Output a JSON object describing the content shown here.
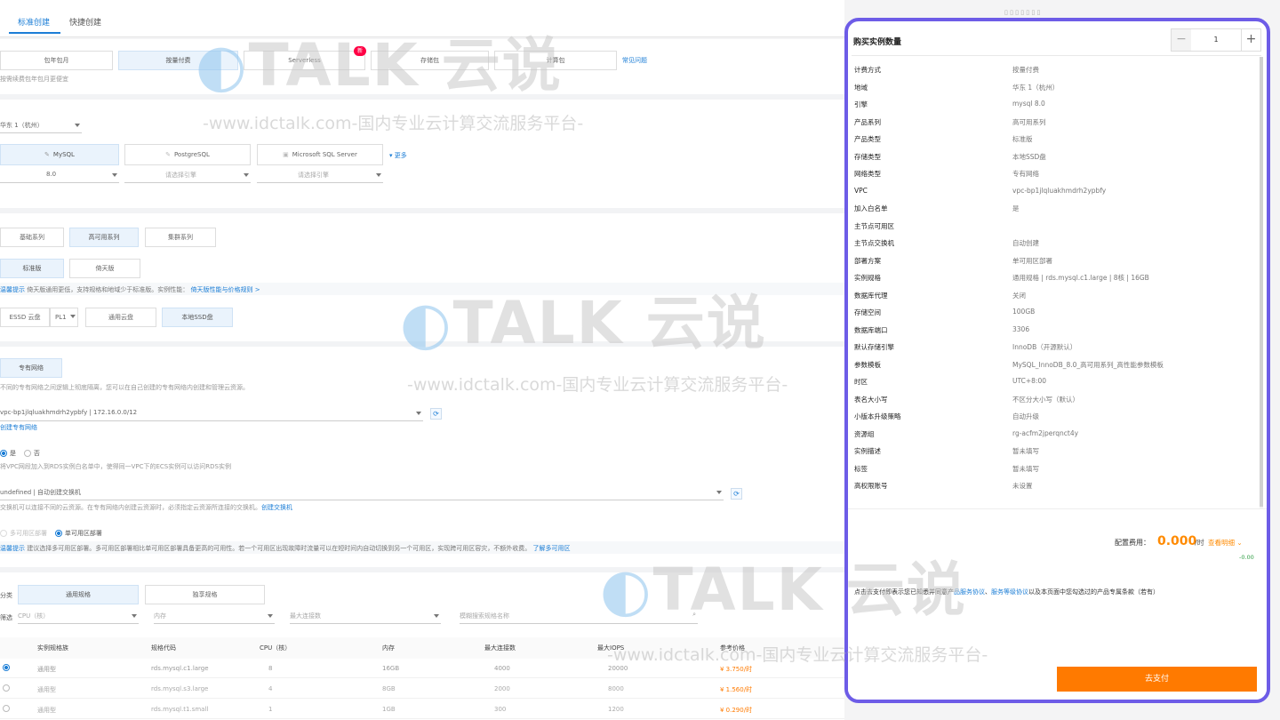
{
  "tabs": [
    {
      "label": "标准创建"
    },
    {
      "label": "快捷创建"
    }
  ],
  "top_right": "▯ ▯ ▯ ▯ ▯ ▯ ▯",
  "billing": {
    "options": [
      "包年包月",
      "按量付费",
      "Serverless",
      "存储包",
      "计算包"
    ],
    "new_badge": "新",
    "note": "按需续费包年包月更便宜",
    "help_link": "常见问题"
  },
  "region": {
    "value": "华东 1（杭州）"
  },
  "engines": [
    {
      "name": "MySQL",
      "version": "8.0"
    },
    {
      "name": "PostgreSQL",
      "version": "请选择引擎"
    },
    {
      "name": "Microsoft SQL Server",
      "version": "请选择引擎"
    }
  ],
  "engines_more": "▾ 更多",
  "series": [
    "基础系列",
    "高可用系列",
    "集群系列"
  ],
  "edition": [
    "标准版",
    "倚天版"
  ],
  "edition_hint": {
    "label": "温馨提示",
    "text": "倚天版通用更低，支持规格和地域少于标准版。实例性能：",
    "link": "倚天版性能与价格规则 >"
  },
  "storage": {
    "type": "ESSD 云盘",
    "level": "PL1",
    "options": [
      "通用云盘",
      "本地SSD盘"
    ]
  },
  "network": {
    "type": "专有网络",
    "desc": "不同的专有网络之间逻辑上彻底隔离，您可以在自己创建的专有网络内创建和管理云资源。",
    "vpc": "vpc-bp1jlqluakhmdrh2ypbfy | 172.16.0.0/12",
    "vpc_link": "创建专有网络"
  },
  "whitelist": {
    "yes": "是",
    "no": "否",
    "note": "将VPC网段加入到RDS实例白名单中，使得同一VPC下的ECS实例可以访问RDS实例"
  },
  "vswitch": {
    "value": "undefined | 自动创建交换机",
    "note": "交换机可以连接不同的云资源。在专有网络内创建云资源时，必须指定云资源所连接的交换机。",
    "link": "创建交换机"
  },
  "deploy": {
    "multi": "多可用区部署",
    "single": "单可用区部署",
    "hint_label": "温馨提示",
    "hint_text": "建议选择多可用区部署。多可用区部署相比单可用区部署具备更高的可用性。若一个可用区出现故障时流量可以在短时间内自动切换到另一个可用区，实现跨可用区容灾，不额外收费。",
    "hint_link": "了解多可用区"
  },
  "spec_type": {
    "label": "分类",
    "options": [
      "通用规格",
      "独享规格"
    ]
  },
  "filters": {
    "label": "筛选",
    "cpu": "CPU（核）",
    "mem": "内存",
    "conn": "最大连接数",
    "search": "模糊搜索规格名称"
  },
  "table": {
    "headers": [
      "实例规格族",
      "规格代码",
      "CPU（核）",
      "内存",
      "最大连接数",
      "最大IOPS",
      "参考价格"
    ],
    "rows": [
      [
        "通用型",
        "rds.mysql.c1.large",
        "8",
        "16GB",
        "4000",
        "20000",
        "¥ 3.750/时"
      ],
      [
        "通用型",
        "rds.mysql.s3.large",
        "4",
        "8GB",
        "2000",
        "8000",
        "¥ 1.560/时"
      ],
      [
        "通用型",
        "rds.mysql.t1.small",
        "1",
        "1GB",
        "300",
        "1200",
        "¥ 0.290/时"
      ]
    ]
  },
  "panel": {
    "title": "购买实例数量",
    "quantity": "1",
    "minus": "−",
    "plus": "+",
    "items": [
      {
        "k": "计费方式",
        "v": "按量付费"
      },
      {
        "k": "地域",
        "v": "华东 1（杭州）"
      },
      {
        "k": "引擎",
        "v": "mysql 8.0"
      },
      {
        "k": "产品系列",
        "v": "高可用系列"
      },
      {
        "k": "产品类型",
        "v": "标准版"
      },
      {
        "k": "存储类型",
        "v": "本地SSD盘"
      },
      {
        "k": "网络类型",
        "v": "专有网络"
      },
      {
        "k": "VPC",
        "v": "vpc-bp1jlqluakhmdrh2ypbfy"
      },
      {
        "k": "加入白名单",
        "v": "是"
      },
      {
        "k": "主节点可用区",
        "v": ""
      },
      {
        "k": "主节点交换机",
        "v": "自动创建"
      },
      {
        "k": "部署方案",
        "v": "单可用区部署"
      },
      {
        "k": "实例规格",
        "v": "通用规格 | rds.mysql.c1.large | 8核 | 16GB"
      },
      {
        "k": "数据库代理",
        "v": "关闭"
      },
      {
        "k": "存储空间",
        "v": "100GB"
      },
      {
        "k": "数据库端口",
        "v": "3306"
      },
      {
        "k": "默认存储引擎",
        "v": "InnoDB（开源默认）"
      },
      {
        "k": "参数模板",
        "v": "MySQL_InnoDB_8.0_高可用系列_高性能参数模板"
      },
      {
        "k": "时区",
        "v": "UTC+8:00"
      },
      {
        "k": "表名大小写",
        "v": "不区分大小写（默认）"
      },
      {
        "k": "小版本升级策略",
        "v": "自动升级"
      },
      {
        "k": "资源组",
        "v": "rg-acfm2jperqnct4y"
      },
      {
        "k": "实例描述",
        "v": "暂未填写"
      },
      {
        "k": "标签",
        "v": "暂未填写"
      },
      {
        "k": "高权限账号",
        "v": "未设置"
      }
    ],
    "fee_label": "配置费用：",
    "fee_value": "0.000",
    "fee_unit": "/时",
    "fee_detail": "查看明细",
    "fee_diff": "-0.00",
    "agreement_prefix": "点击去支付即表示您已知悉并同意产",
    "agreement_link1": "品服务协议",
    "agreement_mid": "、",
    "agreement_link2": "服务等级协议",
    "agreement_suffix": "以及本页面中您勾选过的产品专属条款（若有）",
    "pay_button": "去支付"
  },
  "watermark": {
    "logo": "TALK 云说",
    "url": "-www.idctalk.com-国内专业云计算交流服务平台-"
  },
  "colors": {
    "accent": "#1c7ed6",
    "price": "#ff7a00",
    "panel_border": "#6d5ce7"
  }
}
